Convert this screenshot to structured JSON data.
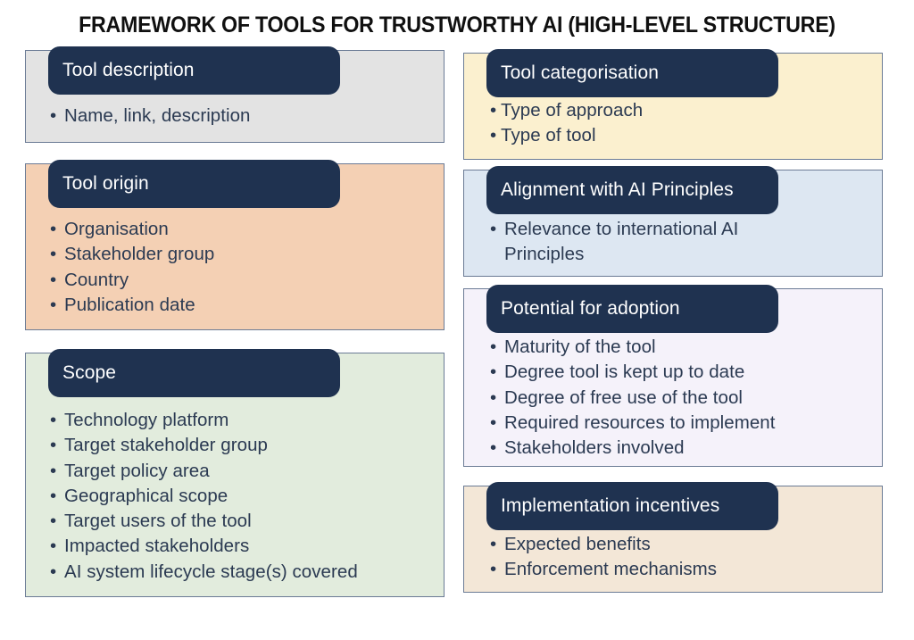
{
  "title": "FRAMEWORK OF TOOLS FOR TRUSTWORTHY AI (HIGH-LEVEL STRUCTURE)",
  "colors": {
    "header_navy": "#1f3250",
    "text_navy": "#2b3a52",
    "border": "#6b7b95",
    "tool_description_bg": "#e3e3e3",
    "tool_origin_bg": "#f4d0b4",
    "scope_bg": "#e2ecdd",
    "tool_categorisation_bg": "#fbf0cf",
    "alignment_bg": "#dde7f2",
    "potential_bg": "#f5f2fa",
    "incentives_bg": "#f3e7d7"
  },
  "left_column": {
    "tool_description": {
      "header": "Tool description",
      "items": [
        "Name, link, description"
      ]
    },
    "tool_origin": {
      "header": "Tool origin",
      "items": [
        "Organisation",
        "Stakeholder group",
        "Country",
        "Publication date"
      ]
    },
    "scope": {
      "header": "Scope",
      "items": [
        "Technology platform",
        "Target stakeholder group",
        "Target policy area",
        "Geographical scope",
        "Target users of the tool",
        "Impacted stakeholders",
        "AI system lifecycle stage(s) covered"
      ]
    }
  },
  "right_column": {
    "tool_categorisation": {
      "header": "Tool categorisation",
      "items": [
        "Type of approach",
        "Type of tool"
      ]
    },
    "alignment": {
      "header": "Alignment with AI Principles",
      "items": [
        "Relevance to international AI Principles"
      ]
    },
    "potential": {
      "header": "Potential for adoption",
      "items": [
        "Maturity of the tool",
        "Degree tool is kept up to date",
        "Degree of free use of the tool",
        "Required resources to implement",
        "Stakeholders involved"
      ]
    },
    "incentives": {
      "header": "Implementation incentives",
      "items": [
        "Expected benefits",
        "Enforcement mechanisms"
      ]
    }
  },
  "bullet_glyph": "•"
}
